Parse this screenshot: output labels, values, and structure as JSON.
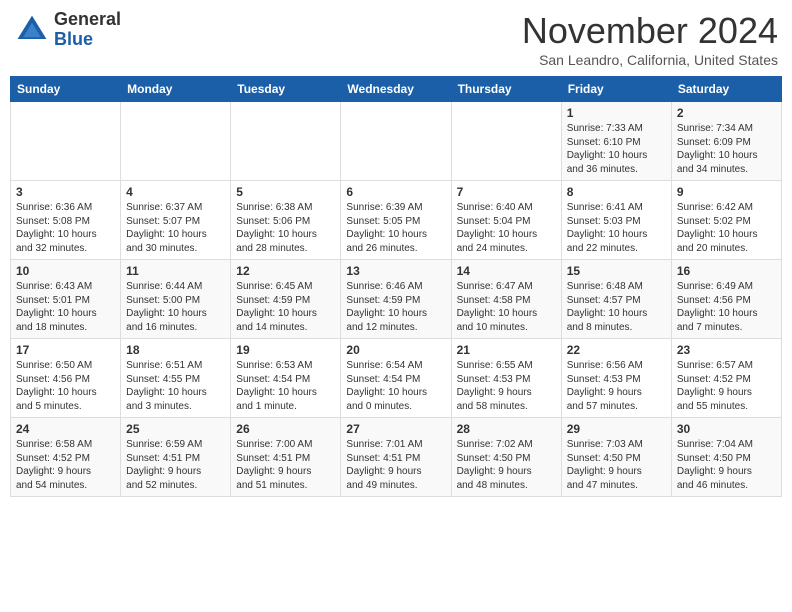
{
  "header": {
    "logo_general": "General",
    "logo_blue": "Blue",
    "month_title": "November 2024",
    "location": "San Leandro, California, United States"
  },
  "weekdays": [
    "Sunday",
    "Monday",
    "Tuesday",
    "Wednesday",
    "Thursday",
    "Friday",
    "Saturday"
  ],
  "weeks": [
    [
      {
        "day": "",
        "info": ""
      },
      {
        "day": "",
        "info": ""
      },
      {
        "day": "",
        "info": ""
      },
      {
        "day": "",
        "info": ""
      },
      {
        "day": "",
        "info": ""
      },
      {
        "day": "1",
        "info": "Sunrise: 7:33 AM\nSunset: 6:10 PM\nDaylight: 10 hours\nand 36 minutes."
      },
      {
        "day": "2",
        "info": "Sunrise: 7:34 AM\nSunset: 6:09 PM\nDaylight: 10 hours\nand 34 minutes."
      }
    ],
    [
      {
        "day": "3",
        "info": "Sunrise: 6:36 AM\nSunset: 5:08 PM\nDaylight: 10 hours\nand 32 minutes."
      },
      {
        "day": "4",
        "info": "Sunrise: 6:37 AM\nSunset: 5:07 PM\nDaylight: 10 hours\nand 30 minutes."
      },
      {
        "day": "5",
        "info": "Sunrise: 6:38 AM\nSunset: 5:06 PM\nDaylight: 10 hours\nand 28 minutes."
      },
      {
        "day": "6",
        "info": "Sunrise: 6:39 AM\nSunset: 5:05 PM\nDaylight: 10 hours\nand 26 minutes."
      },
      {
        "day": "7",
        "info": "Sunrise: 6:40 AM\nSunset: 5:04 PM\nDaylight: 10 hours\nand 24 minutes."
      },
      {
        "day": "8",
        "info": "Sunrise: 6:41 AM\nSunset: 5:03 PM\nDaylight: 10 hours\nand 22 minutes."
      },
      {
        "day": "9",
        "info": "Sunrise: 6:42 AM\nSunset: 5:02 PM\nDaylight: 10 hours\nand 20 minutes."
      }
    ],
    [
      {
        "day": "10",
        "info": "Sunrise: 6:43 AM\nSunset: 5:01 PM\nDaylight: 10 hours\nand 18 minutes."
      },
      {
        "day": "11",
        "info": "Sunrise: 6:44 AM\nSunset: 5:00 PM\nDaylight: 10 hours\nand 16 minutes."
      },
      {
        "day": "12",
        "info": "Sunrise: 6:45 AM\nSunset: 4:59 PM\nDaylight: 10 hours\nand 14 minutes."
      },
      {
        "day": "13",
        "info": "Sunrise: 6:46 AM\nSunset: 4:59 PM\nDaylight: 10 hours\nand 12 minutes."
      },
      {
        "day": "14",
        "info": "Sunrise: 6:47 AM\nSunset: 4:58 PM\nDaylight: 10 hours\nand 10 minutes."
      },
      {
        "day": "15",
        "info": "Sunrise: 6:48 AM\nSunset: 4:57 PM\nDaylight: 10 hours\nand 8 minutes."
      },
      {
        "day": "16",
        "info": "Sunrise: 6:49 AM\nSunset: 4:56 PM\nDaylight: 10 hours\nand 7 minutes."
      }
    ],
    [
      {
        "day": "17",
        "info": "Sunrise: 6:50 AM\nSunset: 4:56 PM\nDaylight: 10 hours\nand 5 minutes."
      },
      {
        "day": "18",
        "info": "Sunrise: 6:51 AM\nSunset: 4:55 PM\nDaylight: 10 hours\nand 3 minutes."
      },
      {
        "day": "19",
        "info": "Sunrise: 6:53 AM\nSunset: 4:54 PM\nDaylight: 10 hours\nand 1 minute."
      },
      {
        "day": "20",
        "info": "Sunrise: 6:54 AM\nSunset: 4:54 PM\nDaylight: 10 hours\nand 0 minutes."
      },
      {
        "day": "21",
        "info": "Sunrise: 6:55 AM\nSunset: 4:53 PM\nDaylight: 9 hours\nand 58 minutes."
      },
      {
        "day": "22",
        "info": "Sunrise: 6:56 AM\nSunset: 4:53 PM\nDaylight: 9 hours\nand 57 minutes."
      },
      {
        "day": "23",
        "info": "Sunrise: 6:57 AM\nSunset: 4:52 PM\nDaylight: 9 hours\nand 55 minutes."
      }
    ],
    [
      {
        "day": "24",
        "info": "Sunrise: 6:58 AM\nSunset: 4:52 PM\nDaylight: 9 hours\nand 54 minutes."
      },
      {
        "day": "25",
        "info": "Sunrise: 6:59 AM\nSunset: 4:51 PM\nDaylight: 9 hours\nand 52 minutes."
      },
      {
        "day": "26",
        "info": "Sunrise: 7:00 AM\nSunset: 4:51 PM\nDaylight: 9 hours\nand 51 minutes."
      },
      {
        "day": "27",
        "info": "Sunrise: 7:01 AM\nSunset: 4:51 PM\nDaylight: 9 hours\nand 49 minutes."
      },
      {
        "day": "28",
        "info": "Sunrise: 7:02 AM\nSunset: 4:50 PM\nDaylight: 9 hours\nand 48 minutes."
      },
      {
        "day": "29",
        "info": "Sunrise: 7:03 AM\nSunset: 4:50 PM\nDaylight: 9 hours\nand 47 minutes."
      },
      {
        "day": "30",
        "info": "Sunrise: 7:04 AM\nSunset: 4:50 PM\nDaylight: 9 hours\nand 46 minutes."
      }
    ]
  ]
}
